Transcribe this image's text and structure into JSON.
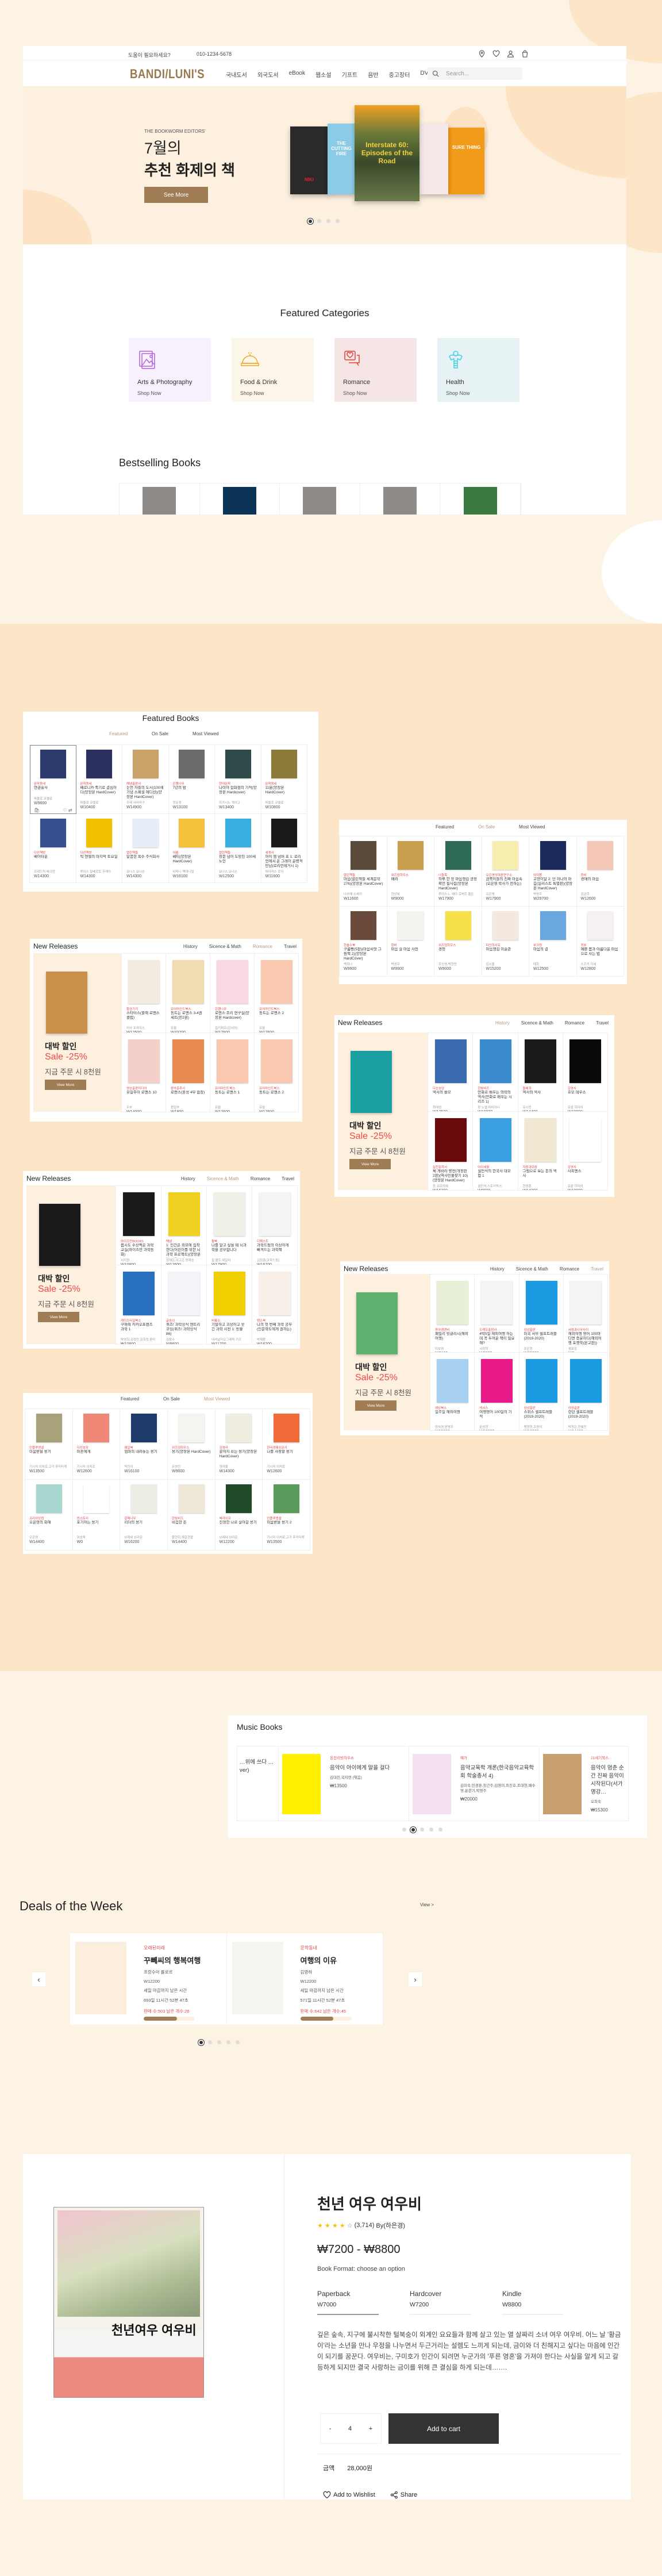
{
  "colors": {
    "accent": "#a07d55",
    "sale_red": "#f04848",
    "page_bg": "#fdf3e4",
    "band_bg": "#fde5c8",
    "hero_bg": "#fdf0df",
    "active_tab": "#b59b7c"
  },
  "header": {
    "help_text": "도움이 필요하세요?",
    "phone": "010-1234-5678",
    "icons": [
      "location-pin-icon",
      "heart-icon",
      "user-icon",
      "shopping-bag-icon"
    ]
  },
  "nav": {
    "logo": "BANDI/LUNI'S",
    "items": [
      "국내도서",
      "외국도서",
      "eBook",
      "웹소설",
      "기프트",
      "음반",
      "중고장터",
      "DVD"
    ],
    "search_placeholder": "Search..."
  },
  "hero": {
    "subtitle": "THE BOOKWORM EDITORS'",
    "title_line1": "7월의",
    "title_line2": "추천 화제의 책",
    "button": "See More",
    "dots": 4,
    "active_dot": 0,
    "covers": [
      {
        "title": "NIKI",
        "color": "#2a2a2a"
      },
      {
        "title": "THE CUTTING FIRE",
        "color": "#8ccbe8"
      },
      {
        "title": "Interstate 60: Episodes of the Road",
        "color": "#5a6a3a"
      },
      {
        "title": "",
        "color": "#f4e8e8"
      },
      {
        "title": "SURE THING",
        "color": "#f29a1a"
      }
    ]
  },
  "categories": {
    "title": "Featured Categories",
    "items": [
      {
        "name": "Arts & Photography",
        "link": "Shop Now",
        "bg": "#f8f0fd",
        "icon": "image-icon",
        "icon_color": "#b463d8"
      },
      {
        "name": "Food & Drink",
        "link": "Shop Now",
        "bg": "#fcf5ea",
        "icon": "food-dome-icon",
        "icon_color": "#f0a828"
      },
      {
        "name": "Romance",
        "link": "Shop Now",
        "bg": "#f5e6e5",
        "icon": "heart-chat-icon",
        "icon_color": "#e0403a"
      },
      {
        "name": "Health",
        "link": "Shop Now",
        "bg": "#e6f2f3",
        "icon": "body-icon",
        "icon_color": "#40d0e8"
      }
    ]
  },
  "bestselling": {
    "title": "Bestselling Books",
    "covers": [
      "#8e8a88",
      "#0c3456",
      "#8e8a88",
      "#8e8a88",
      "#3a7a40"
    ]
  },
  "featured_grids": [
    {
      "title": "Featured Books",
      "tabs": [
        "Featured",
        "On Sale",
        "Most Viewed"
      ],
      "active_tab": 0,
      "items": [
        {
          "publisher": "문학동네",
          "title": "연금술사",
          "author": "파울로 코엘료",
          "price": "W9600",
          "cover": "#2a3a6a"
        },
        {
          "publisher": "문학동네",
          "title": "베로니카 죽기로 결심하다(양장본 HardCover)",
          "author": "파울로 코엘료",
          "price": "W10400",
          "cover": "#2b2f5e"
        },
        {
          "publisher": "해냄출판사",
          "title": "눈먼 자들의 도시(100쇄 기념 스페셜 에디션)(양장본 HardCover)",
          "author": "주제 사라마구",
          "price": "W14900",
          "cover": "#c9a36a"
        },
        {
          "publisher": "은행나무",
          "title": "7년의 밤",
          "author": "정유정",
          "price": "W13100",
          "cover": "#6b6b6b"
        },
        {
          "publisher": "현대문학",
          "title": "나미야 잡화점의 기적(양장본 Hardcover)",
          "author": "히가시노 게이고",
          "price": "W13400",
          "cover": "#2f4a4a"
        },
        {
          "publisher": "문학동네",
          "title": "11분(양장본 HardCover)",
          "author": "파울로 코엘료",
          "price": "W10800",
          "cover": "#8c7a3a"
        },
        {
          "publisher": "다산책방",
          "title": "베어타운",
          "author": "프레드릭 배크만",
          "price": "W14300",
          "cover": "#34508f"
        },
        {
          "publisher": "다산책방",
          "title": "빅 엔젤의 마지막 토요일",
          "author": "루이스 알베르토 우레아",
          "price": "W14300",
          "cover": "#f2c200"
        },
        {
          "publisher": "열린책들",
          "title": "달콤한 복수 주식회사",
          "author": "요나스 요나손",
          "price": "W14300",
          "cover": "#e8eef8"
        },
        {
          "publisher": "아름",
          "title": "베티(양장본 HardCover)",
          "author": "티파니 맥대니얼",
          "price": "W16100",
          "cover": "#f3c23a"
        },
        {
          "publisher": "열린책들",
          "title": "창문 넘어 도망친 100세 노인",
          "author": "요나스 요나손",
          "price": "W12500",
          "cover": "#3aaee0"
        },
        {
          "publisher": "세계사",
          "title": "아이 엠 넘버 포 1: 로리언에서 온 그레이 운명적 만남(로리언레거시 1)",
          "author": "피타커스 로어",
          "price": "W11600",
          "cover": "#1a1a1a"
        }
      ]
    },
    {
      "title": "",
      "tabs": [
        "Featured",
        "On Sale",
        "Most Viewed"
      ],
      "active_tab": 1,
      "items": [
        {
          "publisher": "열린책들",
          "title": "마음(열린책들 세계문학 276)(양장본 HardCover)",
          "author": "나쓰메 소세키",
          "price": "W11600",
          "cover": "#5a4a3a"
        },
        {
          "publisher": "위즈덤하우스",
          "title": "배려",
          "author": "한상복",
          "price": "W9000",
          "cover": "#c8a050"
        },
        {
          "publisher": "나들목",
          "title": "하루 한 장 마음챙김 긍정 확언 필사집(양장본 HardCover)",
          "author": "루이스 L. 헤이·로버트 홀든",
          "price": "W17900",
          "cover": "#2e6b55"
        },
        {
          "publisher": "오은영의마음연구소",
          "title": "금쪽이들의 진짜 마음속(오은영 박사가 전하는)",
          "author": "오은영",
          "price": "W17900",
          "cover": "#f7efb0"
        },
        {
          "publisher": "아띠봄",
          "title": "고양이달 2: 단 하나의 마음(일러스트 특별판)(양장본 HardCover)",
          "author": "박영주",
          "price": "W29700",
          "cover": "#1a2a5a"
        },
        {
          "publisher": "창비",
          "title": "경애의 마음",
          "author": "김금희",
          "price": "W12600",
          "cover": "#f4c6b8"
        },
        {
          "publisher": "한솔수북",
          "title": "구름빵(5판)(마음씨앗 그림책 2)(양장본 HardCover)",
          "author": "백희나",
          "price": "W9900",
          "cover": "#6a4a3a"
        },
        {
          "publisher": "창비",
          "title": "마음 살 마음 사전",
          "author": "박성우",
          "price": "W9900",
          "cover": "#f4f4ee"
        },
        {
          "publisher": "위즈덤하우스",
          "title": "경청",
          "author": "조신영,박현찬",
          "price": "W9000",
          "cover": "#f7e14a"
        },
        {
          "publisher": "타인의사유",
          "title": "마음챙김 미술관",
          "author": "김소울",
          "price": "W15200",
          "cover": "#f5e8e0"
        },
        {
          "publisher": "부크럼",
          "title": "마음의 결",
          "author": "태희",
          "price": "W12500",
          "cover": "#6aa6e0"
        },
        {
          "publisher": "정호",
          "title": "예쁜 몸과 아름다운 마음으로 사는 법",
          "author": "스즈키 지세",
          "price": "W12800",
          "cover": "#f4f0f4"
        }
      ]
    },
    {
      "title": "",
      "tabs": [
        "Featured",
        "On Sale",
        "Most Viewed"
      ],
      "active_tab": 2,
      "items": [
        {
          "publisher": "인플루엔셜",
          "title": "미움받을 용기",
          "author": "기시미 이치로,고가 후미타케",
          "price": "W13500",
          "cover": "#a8a27a"
        },
        {
          "publisher": "다산초당",
          "title": "마흔에게",
          "author": "기시미 이치로",
          "price": "W12600",
          "cover": "#f08878"
        },
        {
          "publisher": "웨일북",
          "title": "엄마의 내려놓는 용기",
          "author": "박진아",
          "price": "W16100",
          "cover": "#1e3a6a"
        },
        {
          "publisher": "위즈덤하우스",
          "title": "용기(양장본 HardCover)",
          "author": "유영만",
          "price": "W9000",
          "cover": "#f4f4f0"
        },
        {
          "publisher": "김영사",
          "title": "끝까지 쓰는 용기(양장본 HardCover)",
          "author": "정여울",
          "price": "W14300",
          "cover": "#efeee0"
        },
        {
          "publisher": "한국경제신문사",
          "title": "나를 사랑할 용기",
          "author": "기시미 이치로",
          "price": "W12600",
          "cover": "#f06a3a"
        },
        {
          "publisher": "코리아닷컴",
          "title": "오은영의 화해",
          "author": "오은영",
          "price": "W14400",
          "cover": "#a8d8d0"
        },
        {
          "publisher": "덴스토리",
          "title": "포기하는 용기",
          "author": "이승욱",
          "price": "W0",
          "cover": "#ffffff"
        },
        {
          "publisher": "갈매나무",
          "title": "리더의 용기",
          "author": "브레네 브라운",
          "price": "W16200",
          "cover": "#efeee6"
        },
        {
          "publisher": "한빛비즈",
          "title": "비겁한 돈",
          "author": "황현희,제갈현열",
          "price": "W14400",
          "cover": "#f0e8d8"
        },
        {
          "publisher": "북라이프",
          "title": "진정한 나로 살아갈 용기",
          "author": "브레네 브라운",
          "price": "W12200",
          "cover": "#1e4a2a"
        },
        {
          "publisher": "인플루엔셜",
          "title": "미움받을 용기 2",
          "author": "기시미 이치로,고가 후미타케",
          "price": "W13500",
          "cover": "#5a9a5a"
        }
      ]
    }
  ],
  "new_releases": [
    {
      "title": "New Releases",
      "tabs": [
        "History",
        "Sicence & Math",
        "Romance",
        "Travel"
      ],
      "active_tab": 2,
      "promo": {
        "heading": "대박 할인",
        "sale": "Sale -25%",
        "note": "지금 주문 시 8천원",
        "button": "View More",
        "cover": "#c8904a"
      },
      "items": [
        {
          "publisher": "황금가지",
          "title": "스타터스(블랙 로맨스 클럽)",
          "author": "리사 프라이스",
          "price": "W12500",
          "cover": "#f4ece0"
        },
        {
          "publisher": "유어마인드북스",
          "title": "동트는 로맨스 3-4권 세트(전2권)",
          "author": "유월",
          "price": "W43200",
          "cover": "#f0dcb0"
        },
        {
          "publisher": "은행나무",
          "title": "로맨스 조리 연구실(양장본 Hardcover)",
          "author": "밀키퍼프(김서아)",
          "price": "W17600",
          "cover": "#f9d8e4"
        },
        {
          "publisher": "유어마인드북스",
          "title": "동트는 로맨스 2",
          "author": "유월",
          "price": "W12600",
          "cover": "#f8c8b0"
        },
        {
          "publisher": "영상출판미디어",
          "title": "유일무이 로맨스 10",
          "author": "두부",
          "price": "W14000",
          "cover": "#f4d0c8"
        },
        {
          "publisher": "음악춘추사",
          "title": "로맨스(혼성 4부 합창)",
          "author": "편집부",
          "price": "W1800",
          "cover": "#e88a50"
        },
        {
          "publisher": "유어마인드북스",
          "title": "동트는 로맨스 1",
          "author": "유월",
          "price": "W12600",
          "cover": "#f8c8b0"
        },
        {
          "publisher": "유어마인드북스",
          "title": "동트는 로맨스 2",
          "author": "유월",
          "price": "W12600",
          "cover": "#f8c8b0"
        }
      ]
    },
    {
      "title": "New Releases",
      "tabs": [
        "History",
        "Sicence & Math",
        "Romance",
        "Travel"
      ],
      "active_tab": 0,
      "promo": {
        "heading": "대박 할인",
        "sale": "Sale -25%",
        "note": "지금 주문 시 8천원",
        "button": "View More",
        "cover": "#1aa0a0"
      },
      "items": [
        {
          "publisher": "다산초당",
          "title": "역사의 쓸모",
          "author": "최태성",
          "price": "W13500",
          "cover": "#3a6ab0"
        },
        {
          "publisher": "한빛비즈",
          "title": "만화로 배우는 의학의 역사(만화로 배우는 시리즈 1)",
          "author": "장 노엘 파비아니",
          "price": "W18800",
          "cover": "#3a8ad0"
        },
        {
          "publisher": "돌베개",
          "title": "역사의 역사",
          "author": "유시민",
          "price": "W14400",
          "cover": "#1a1a1a"
        },
        {
          "publisher": "김영사",
          "title": "호모 데우스",
          "author": "유발 하라리",
          "price": "W19800",
          "cover": "#0a0a0a"
        },
        {
          "publisher": "실천문학사",
          "title": "체 게바라 평전(개정판 2판)(역사인물찾기 10)(양장본 HardCover)",
          "author": "장 코르미에",
          "price": "W16200",
          "cover": "#6a0a0a"
        },
        {
          "publisher": "아이세움",
          "title": "설민석의 한국사 대모험 1",
          "author": "설민석,스토리박스",
          "price": "W8900",
          "cover": "#3aa0e0"
        },
        {
          "publisher": "자음과모음",
          "title": "그림으로 보는 돈의 역사",
          "author": "한정훈",
          "price": "W14300",
          "cover": "#f0e8d0"
        },
        {
          "publisher": "김영사",
          "title": "사피엔스",
          "author": "유발 하라리",
          "price": "W19800",
          "cover": "#ffffff"
        }
      ]
    },
    {
      "title": "New Releases",
      "tabs": [
        "History",
        "Sicence & Math",
        "Romance",
        "Travel"
      ],
      "active_tab": 1,
      "promo": {
        "heading": "대박 할인",
        "sale": "Sale -25%",
        "note": "지금 주문 시 8천원",
        "button": "View More",
        "cover": "#1a1a1a"
      },
      "items": [
        {
          "publisher": "와이즈만BOOKS",
          "title": "몹시도 수상쩍은 과학교실(와이즈만 과학동화)",
          "author": "서지원",
          "price": "W10800",
          "cover": "#1a1a1a"
        },
        {
          "publisher": "해냄",
          "title": "1: 인간은 외모에 집착한다(어린이를 위한 뇌과학 프로젝트)(양장본 HardCover)",
          "author": "정재은,이고은,정재승",
          "price": "W12600",
          "cover": "#f0d020"
        },
        {
          "publisher": "윌북",
          "title": "나를 알고 싶을 때 뇌과학을 공부합니다",
          "author": "질 볼트 테일러",
          "price": "W17900",
          "cover": "#f0f0e8"
        },
        {
          "publisher": "더퀘스트",
          "title": "과학드림의 이상하게 빠져드는 과학책",
          "author": "김정훈(과학드림)",
          "price": "W16700",
          "cover": "#f4f4f4"
        },
        {
          "publisher": "케이스타일북스",
          "title": "구해줘 카카오프렌즈 과학 1",
          "author": "박영희,김정민,김희정,윤미숙",
          "price": "W10800",
          "cover": "#2a70c0"
        },
        {
          "publisher": "글송이",
          "title": "퀴즈! 과학상식 엔트리 코딩(퀴즈! 과학상식 86)",
          "author": "김응수",
          "price": "W8600",
          "cover": "#f4f4f8"
        },
        {
          "publisher": "비룡소",
          "title": "기발하고 괴상하고 웃긴 과학 사전 1: 동물",
          "author": "내셔널지오그래픽 키즈",
          "price": "W11700",
          "cover": "#f0d000"
        },
        {
          "publisher": "땡스북",
          "title": "나의 첫 번째 과학 공부(인문학도에게 권하는)",
          "author": "박재용",
          "price": "W16200",
          "cover": "#f8f0e8"
        }
      ]
    },
    {
      "title": "New Releases",
      "tabs": [
        "History",
        "Sicence & Math",
        "Romance",
        "Travel"
      ],
      "active_tab": 3,
      "promo": {
        "heading": "대박 할인",
        "sale": "Sale -25%",
        "note": "지금 주문 시 8천원",
        "button": "View More",
        "cover": "#60b070"
      },
      "items": [
        {
          "publisher": "동아엠앤비",
          "title": "패밀리 잉글리시(해외여행)",
          "author": "이보영",
          "price": "W8100",
          "cover": "#e8f0d8"
        },
        {
          "publisher": "도레도출판사",
          "title": "4박5일 해외여행 하는데 꼭 두꺼운 책이 필요해?",
          "author": "서정혁",
          "price": "W9800",
          "cover": "#f4f4f4"
        },
        {
          "publisher": "상상출판",
          "title": "미국 서부 셀프트래블(2019-2020)",
          "author": "조은정",
          "price": "W15200",
          "cover": "#1a9ae0"
        },
        {
          "publisher": "사람과나무사이",
          "title": "해외여행 영어 100마디면 충분하다(해외여행 포켓북(본고판))",
          "author": "샘표킴",
          "price": "W0",
          "cover": "#f4f4f4"
        },
        {
          "publisher": "예담북스",
          "title": "일주일 해외여행",
          "author": "정숙영,윤영주",
          "price": "W15200",
          "cover": "#a8d0f0"
        },
        {
          "publisher": "넥서스",
          "title": "여행영어 100일의 기적",
          "author": "문성현",
          "price": "W10800",
          "cover": "#e81a8a"
        },
        {
          "publisher": "상상출판",
          "title": "스위스 셀프트래블(2019-2020)",
          "author": "맹현정,조원미",
          "price": "W16200",
          "cover": "#1a9ae0"
        },
        {
          "publisher": "상상출판",
          "title": "런던 셀프트래블(2019-2020)",
          "author": "박정은,전혜진",
          "price": "W14400",
          "cover": "#1a9ae0"
        }
      ]
    }
  ],
  "music": {
    "title": "Music Books",
    "dots": 5,
    "active_dot": 1,
    "items": [
      {
        "publisher": "",
        "title": "…위에 쓰다 …ver)",
        "author": "",
        "price": "",
        "cover": ""
      },
      {
        "publisher": "웅진리빙하우스",
        "title": "음악이 아이에게 말을 걸다",
        "author": "김대진,국지연 (엮음)",
        "price": "₩13500",
        "cover": "#fff000"
      },
      {
        "publisher": "예가",
        "title": "음악교육학 개론(한국음악교육학회 학술총서 4)",
        "author": "김미숙,민경훈,장근주,김영미,최진호,조대현,배수영,윤관기,박영주",
        "price": "₩20000",
        "cover": "#f4e0f0"
      },
      {
        "publisher": "21세기북스",
        "title": "음악이 멈춘 순간 진짜 음악이 시작된다(서가명강…",
        "author": "오희숙",
        "price": "₩15300",
        "cover": "#c8a070"
      }
    ]
  },
  "deals": {
    "title": "Deals of the Week",
    "view_link": "View >",
    "dots": 5,
    "active_dot": 0,
    "time_label": "세일 마감까지 남은 시간",
    "items": [
      {
        "publisher": "오래된미래",
        "title": "꾸뻬씨의 행복여행",
        "author": "프랑수아 를로르",
        "price": "W12200",
        "countdown": "693일 11시간 52분 47초",
        "sold": "판매 수:503 남은 개수:26",
        "progress_pct": 65,
        "cover": "#fbeedc"
      },
      {
        "publisher": "문학동네",
        "title": "여행의 이유",
        "author": "김영하",
        "price": "W12200",
        "countdown": "571일 11시간 52분 47초",
        "sold": "판매 수:642 남은 개수:45",
        "progress_pct": 65,
        "cover": "#f4f4f0"
      }
    ]
  },
  "product": {
    "title": "천년 여우 여우비",
    "cover_title": "천년여우 여우비",
    "rating": 4,
    "rating_max": 5,
    "review_count": "(3,714)",
    "by": "By(하은경)",
    "price_range": "₩7200 - ₩8800",
    "format_label": "Book Format: choose an option",
    "formats": [
      {
        "name": "Paperback",
        "price": "W7000"
      },
      {
        "name": "Hardcover",
        "price": "W7200"
      },
      {
        "name": "Kindle",
        "price": "W8800"
      }
    ],
    "selected_format": 0,
    "description": "깊은 숲속, 지구에 불시착한 털북숭이 외계인 요요들과 함께 살고 있는 열 살짜리 소녀 여우 여우비. 어느 날 '황금이'라는 소년을 만나 우정을 나누면서 두근거리는 설렘도 느끼게 되는데, 금이와 더 친해지고 싶다는 마음에 인간이 되기를 꿈꾼다. 여우비는, 구미호가 인간이 되려면 누군가의 '푸른 영혼'을 가져야 한다는 사실을 알게 되고 갈등하게 되지만 결국 사랑하는 금이를 위해 큰 결심을 하게 되는데…….",
    "qty_minus": "-",
    "quantity": "4",
    "qty_plus": "+",
    "add_to_cart": "Add to cart",
    "total_label": "금액",
    "total": "28,000원",
    "wishlist": "Add to Wishlist",
    "share": "Share"
  }
}
